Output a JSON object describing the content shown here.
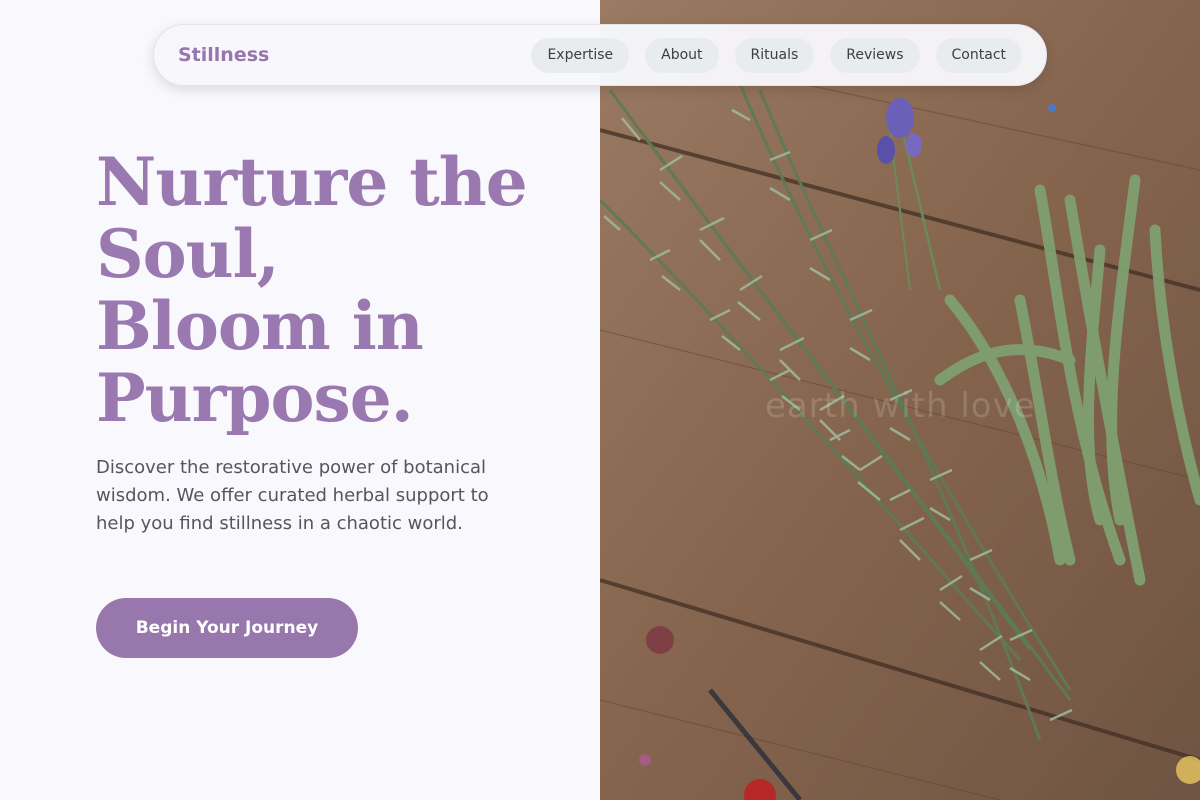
{
  "nav": {
    "brand": "Stillness",
    "links": [
      "Expertise",
      "About",
      "Rituals",
      "Reviews",
      "Contact"
    ]
  },
  "hero": {
    "title_lines": [
      "Nurture the",
      "Soul,",
      "Bloom in",
      "Purpose."
    ],
    "description": "Discover the restorative power of botanical wisdom. We offer curated herbal support to help you find stillness in a chaotic world.",
    "cta_label": "Begin Your Journey"
  },
  "image": {
    "subject": "rosemary, lavender and green beans on a wooden table",
    "watermark": "earth with love"
  },
  "colors": {
    "accent": "#9877ad",
    "background": "#f8f8fd",
    "text_muted": "#55555f"
  }
}
